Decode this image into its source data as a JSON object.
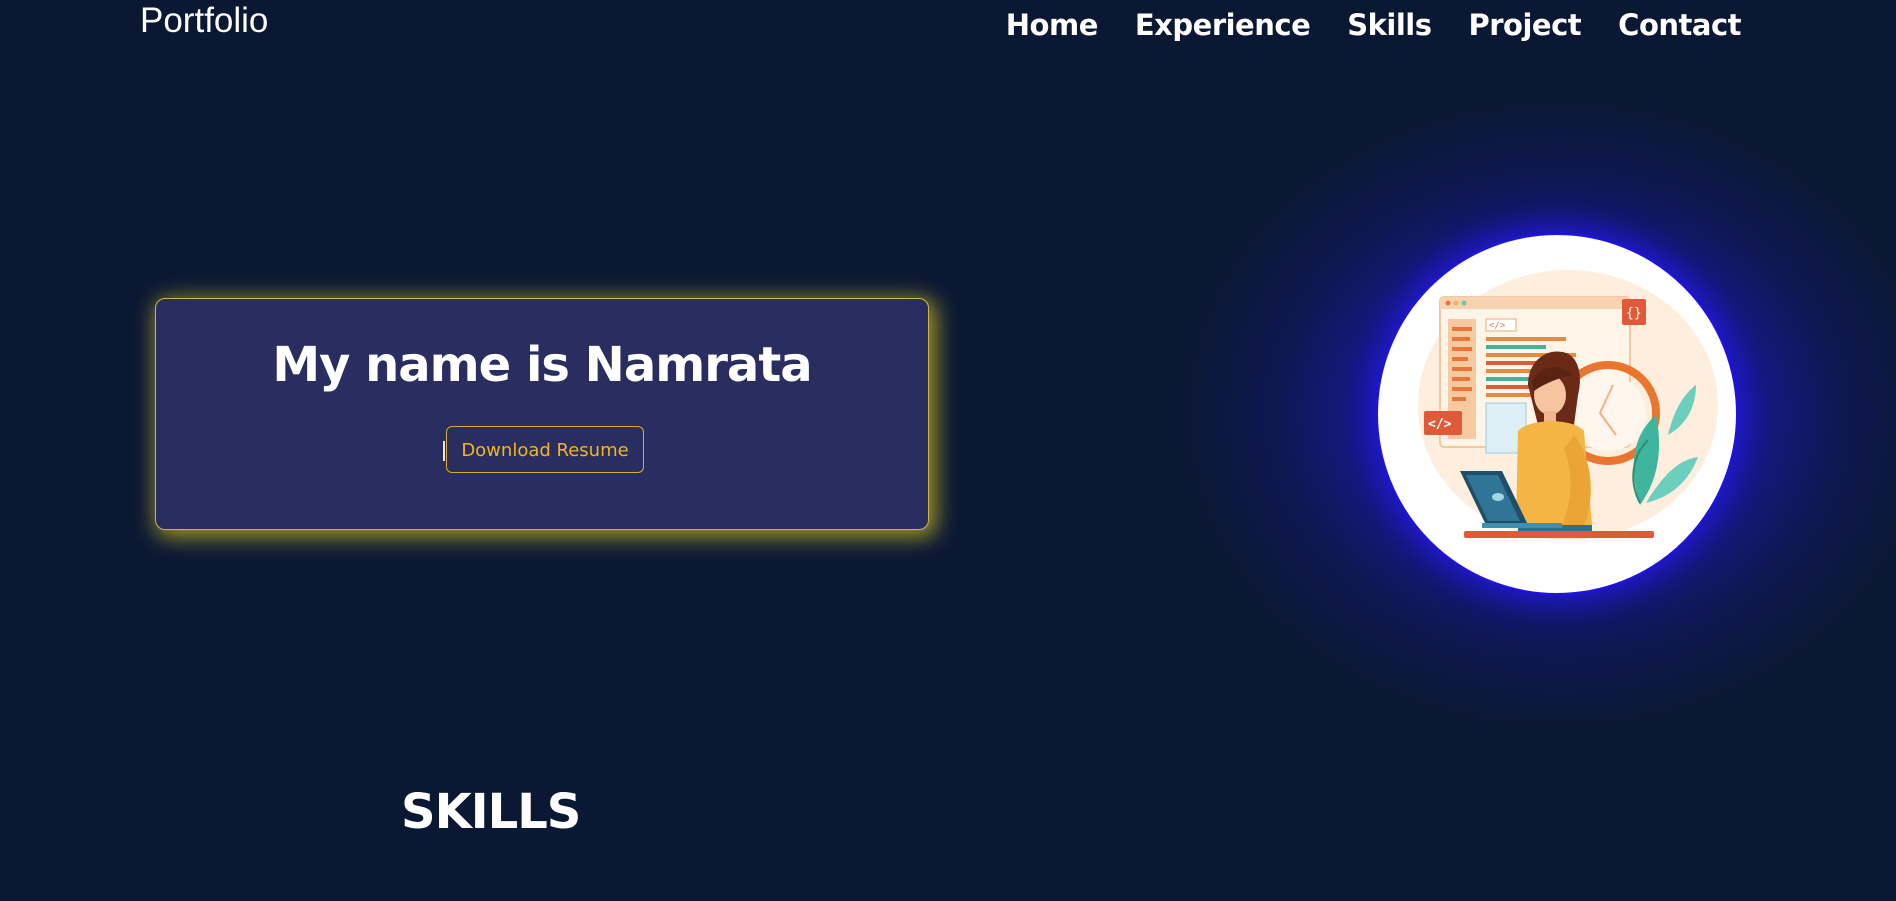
{
  "header": {
    "brand": "Portfolio",
    "nav": [
      {
        "label": "Home"
      },
      {
        "label": "Experience"
      },
      {
        "label": "Skills"
      },
      {
        "label": "Project"
      },
      {
        "label": "Contact"
      }
    ]
  },
  "hero": {
    "title": "My name is Namrata",
    "resume_button": "Download Resume",
    "illustration": {
      "icon": "developer-with-laptop-illustration",
      "code_tag_labels": [
        "</>",
        "</>",
        "{}"
      ]
    }
  },
  "skills": {
    "title": "SKILLS"
  },
  "colors": {
    "background": "#0b1833",
    "card": "#292d5f",
    "card_glow": "#d6c429",
    "button_text": "#f2b71d",
    "avatar_glow": "#1d14d6",
    "text": "#ffffff"
  }
}
